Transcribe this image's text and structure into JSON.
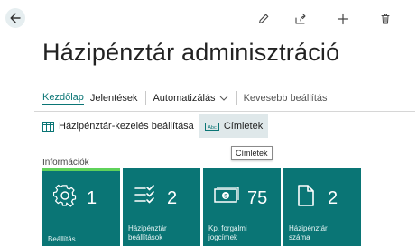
{
  "page": {
    "title": "Házipénztár adminisztráció"
  },
  "toolbar": {
    "icons": [
      "back-arrow-icon",
      "pencil-icon",
      "share-icon",
      "plus-icon",
      "trash-icon"
    ]
  },
  "nav": {
    "items": [
      {
        "label": "Kezdőlap",
        "active": true
      },
      {
        "label": "Jelentések"
      },
      {
        "label": "Automatizálás"
      },
      {
        "label": "Kevesebb beállítás"
      }
    ]
  },
  "actions": {
    "setup_label": "Házipénztár-kezelés beállítása",
    "denominations_label": "Címletek"
  },
  "tooltip": {
    "text": "Címletek"
  },
  "section": {
    "label": "Információk"
  },
  "tiles": [
    {
      "value": "1",
      "label": [
        "Beállítás"
      ],
      "icon": "gear-icon"
    },
    {
      "value": "2",
      "label": [
        "Házipénztár",
        "beállítások"
      ],
      "icon": "checklist-icon"
    },
    {
      "value": "75",
      "label": [
        "Kp. forgalmi",
        "jogcímek"
      ],
      "icon": "cash-icon"
    },
    {
      "value": "2",
      "label": [
        "Házipénztár",
        "száma"
      ],
      "icon": "document-icon"
    }
  ],
  "colors": {
    "accent": "#0a7575",
    "tile_highlight": "#5fd25a"
  }
}
